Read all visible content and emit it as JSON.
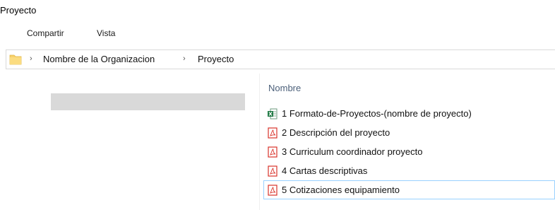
{
  "window": {
    "title": "Proyecto"
  },
  "ribbon": {
    "tabs": [
      "Compartir",
      "Vista"
    ]
  },
  "address_bar": {
    "icon": "folder-icon",
    "path": [
      "Nombre de la Organizacion",
      "Proyecto"
    ],
    "separator": "›"
  },
  "file_list": {
    "column_header": "Nombre",
    "items": [
      {
        "name": "1 Formato-de-Proyectos-(nombre de proyecto)",
        "icon": "excel-file-icon",
        "selected": false
      },
      {
        "name": "2 Descripción del proyecto",
        "icon": "pdf-file-icon",
        "selected": false
      },
      {
        "name": "3 Curriculum coordinador proyecto",
        "icon": "pdf-file-icon",
        "selected": false
      },
      {
        "name": "4 Cartas descriptivas",
        "icon": "pdf-file-icon",
        "selected": false
      },
      {
        "name": "5 Cotizaciones equipamiento",
        "icon": "pdf-file-icon",
        "selected": true
      }
    ]
  },
  "colors": {
    "header_text": "#4c607a",
    "selection_border": "#99d1ff",
    "pdf_red": "#d9322a",
    "excel_green": "#1f7a44",
    "folder_yellow": "#f8d16a"
  }
}
